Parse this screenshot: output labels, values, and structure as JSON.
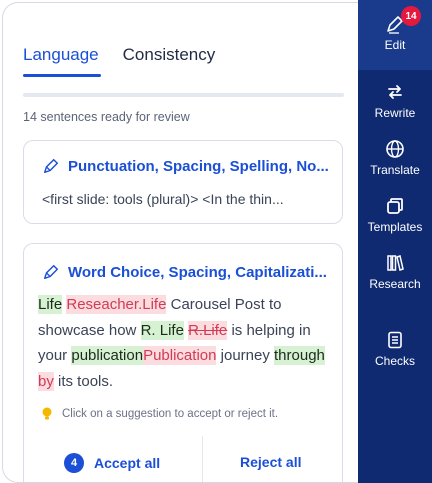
{
  "tabs": [
    {
      "label": "Language",
      "active": true
    },
    {
      "label": "Consistency",
      "active": false
    }
  ],
  "review_count_text": "14 sentences ready for review",
  "card1": {
    "title": "Punctuation, Spacing, Spelling, No...",
    "preview": "<first slide: tools (plural)> <In the thin..."
  },
  "card2": {
    "title": "Word Choice, Spacing, Capitalizati...",
    "segments": {
      "s1": "Life",
      "s2": "Reseacher.Life",
      "s3": "Carousel Post to showcase how",
      "s4": "R. Life",
      "s5": "R.Life",
      "s6": "is helping in your",
      "s7": "publication",
      "s8": "Publication",
      "s9": "journey",
      "s10": "through",
      "s11": "by",
      "s12": "its tools."
    },
    "hint": "Click on a suggestion to accept or reject it.",
    "accept_count": "4",
    "accept_label": "Accept all",
    "reject_label": "Reject all"
  },
  "sidebar": {
    "notification_count": "14",
    "items": [
      {
        "label": "Edit",
        "icon": "pen-icon"
      },
      {
        "label": "Rewrite",
        "icon": "swap-arrows-icon"
      },
      {
        "label": "Translate",
        "icon": "globe-icon"
      },
      {
        "label": "Templates",
        "icon": "templates-icon"
      },
      {
        "label": "Research",
        "icon": "books-icon"
      },
      {
        "label": "Checks",
        "icon": "checklist-icon"
      }
    ]
  },
  "colors": {
    "accent": "#1a4fd6",
    "sidebar": "#102a72",
    "insert_bg": "#d7f1d3",
    "delete_bg": "#fbdde0",
    "delete_text": "#d23a55",
    "badge": "#e5183d"
  }
}
